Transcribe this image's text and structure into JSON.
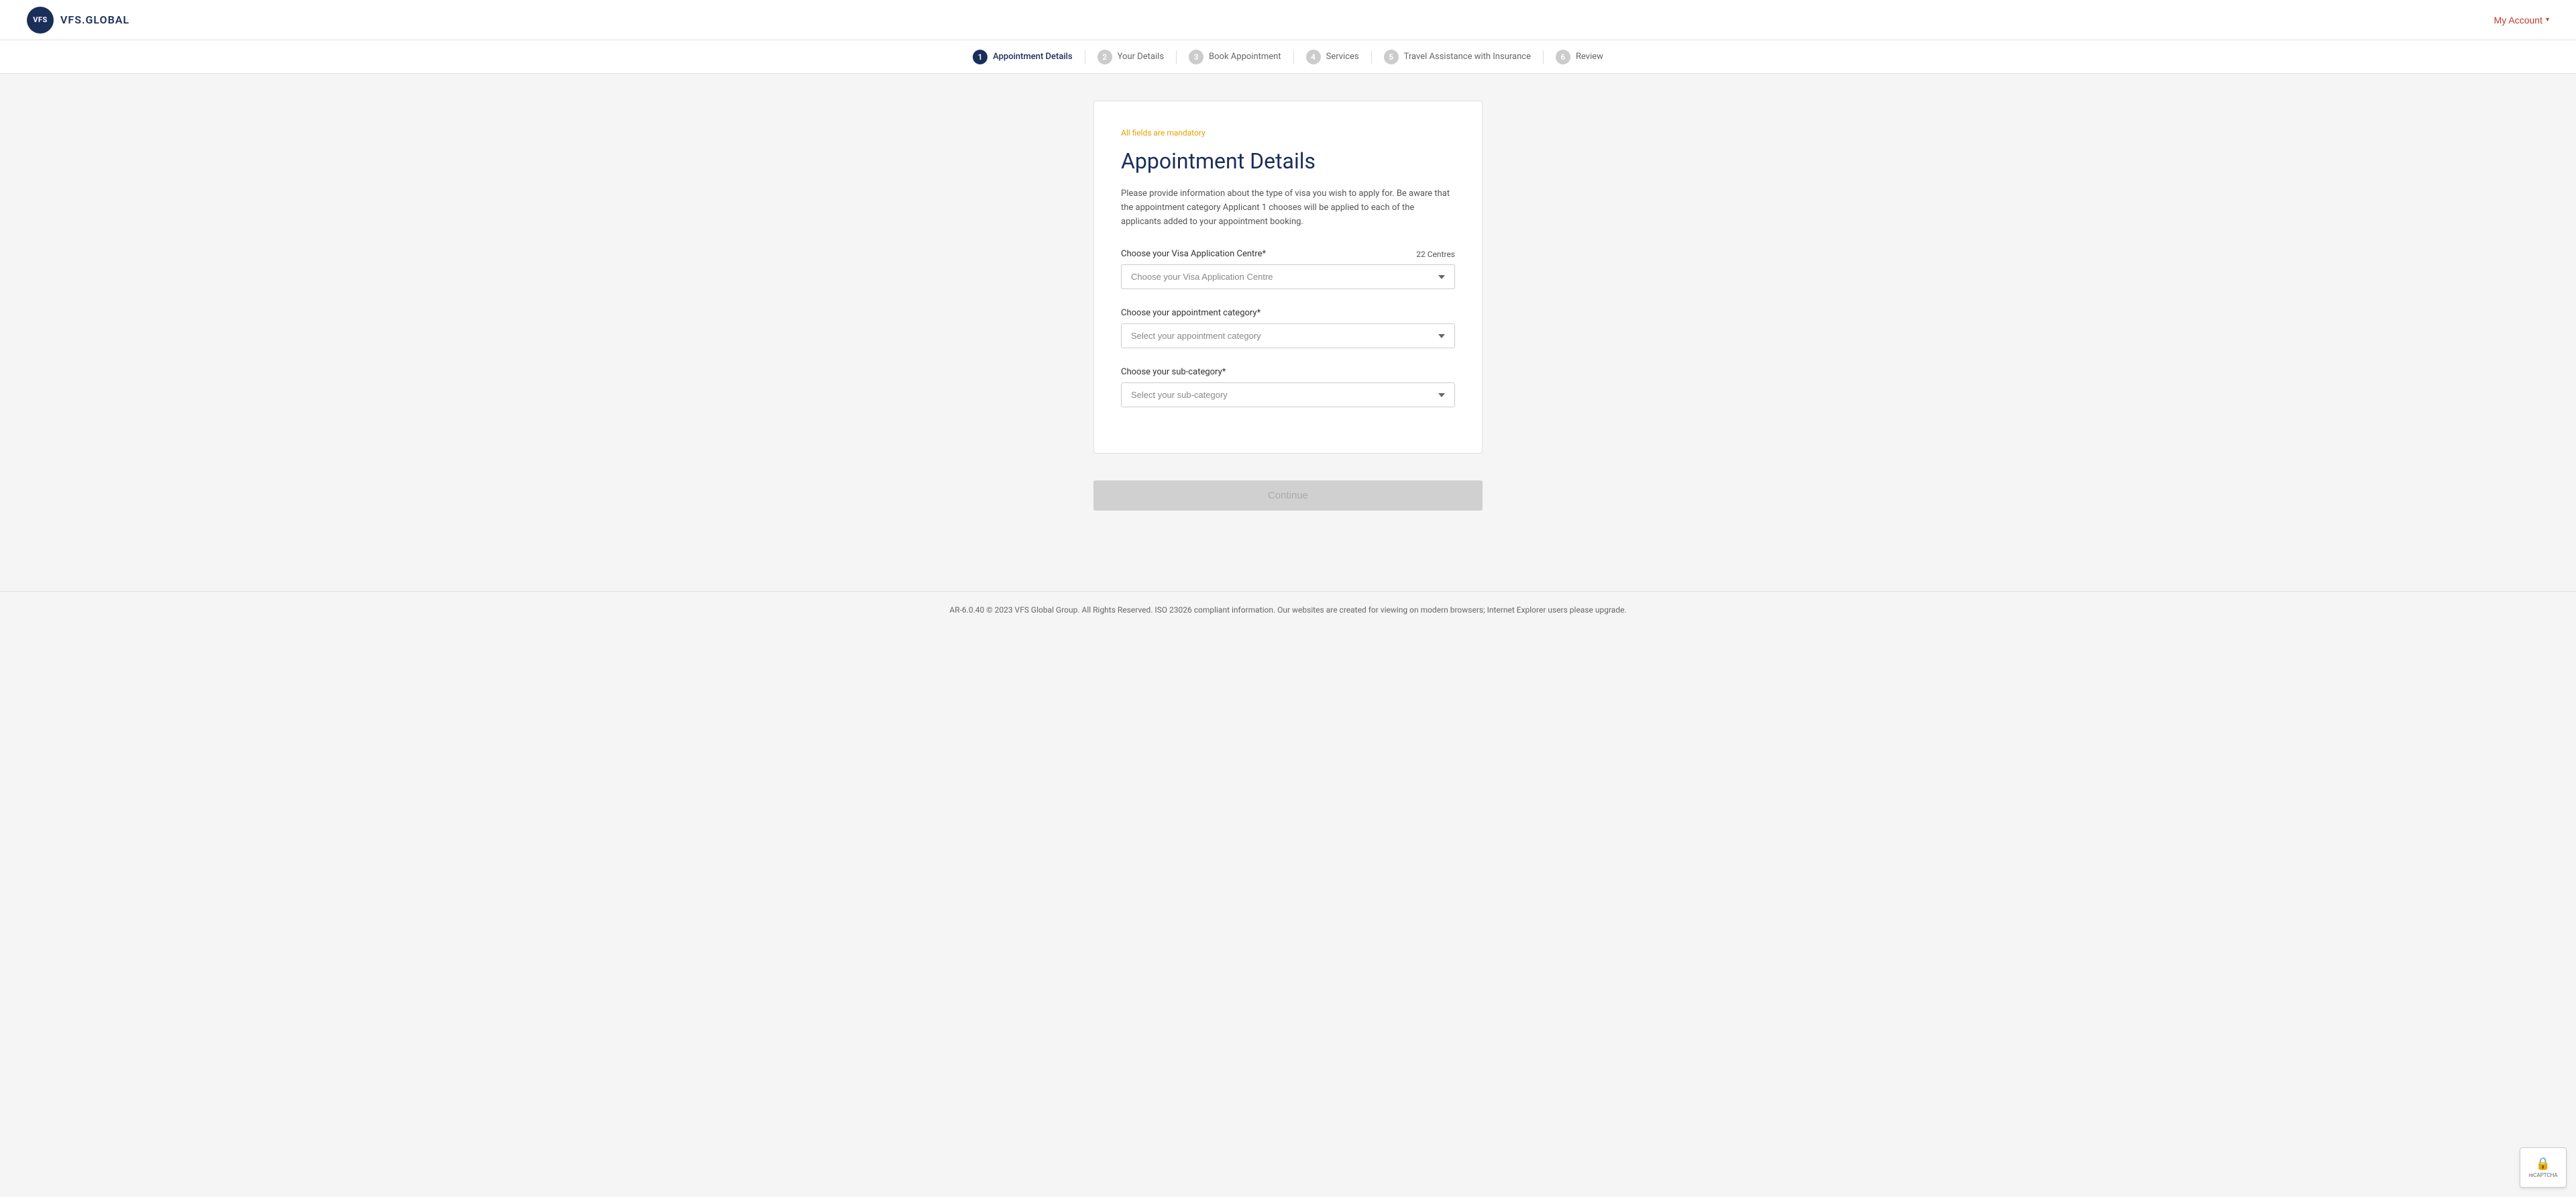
{
  "header": {
    "logo_text": "VFS.GLOBAL",
    "logo_abbr": "VFS",
    "my_account_label": "My Account"
  },
  "steps": [
    {
      "number": "1",
      "label": "Appointment Details",
      "active": true
    },
    {
      "number": "2",
      "label": "Your Details",
      "active": false
    },
    {
      "number": "3",
      "label": "Book Appointment",
      "active": false
    },
    {
      "number": "4",
      "label": "Services",
      "active": false
    },
    {
      "number": "5",
      "label": "Travel Assistance with Insurance",
      "active": false
    },
    {
      "number": "6",
      "label": "Review",
      "active": false
    }
  ],
  "form": {
    "mandatory_text": "All fields are mandatory",
    "title": "Appointment Details",
    "description": "Please provide information about the type of visa you wish to apply for. Be aware that the appointment category Applicant 1 chooses will be applied to each of the applicants added to your appointment booking.",
    "visa_centre": {
      "label": "Choose your Visa Application Centre*",
      "count_label": "22 Centres",
      "placeholder": "Choose your Visa Application Centre"
    },
    "appointment_category": {
      "label": "Choose your appointment category*",
      "placeholder": "Select your appointment category"
    },
    "sub_category": {
      "label": "Choose your sub-category*",
      "placeholder": "Select your sub-category"
    },
    "continue_button": "Continue"
  },
  "footer": {
    "text": "AR-6.0.40 © 2023 VFS Global Group. All Rights Reserved. ISO 23026 compliant information. Our websites are created for viewing on modern browsers; Internet Explorer users please upgrade."
  },
  "recaptcha": {
    "label": "reCAPTCHA"
  }
}
